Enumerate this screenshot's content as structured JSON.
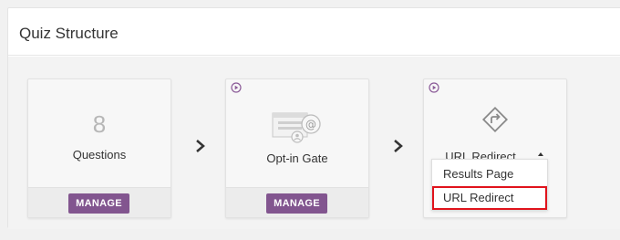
{
  "header": {
    "title": "Quiz Structure"
  },
  "cards": {
    "questions": {
      "count": "8",
      "label": "Questions",
      "button": "MANAGE"
    },
    "optin": {
      "label": "Opt-in Gate",
      "button": "MANAGE"
    },
    "redirect": {
      "label": "URL Redirect"
    }
  },
  "dropdown": {
    "options": [
      "Results Page",
      "URL Redirect"
    ],
    "selected": "URL Redirect"
  },
  "colors": {
    "accent": "#82558f",
    "highlight_outline": "#e0131c",
    "play_icon": "#8b5b98"
  },
  "icons": {
    "play": "play-circle-icon",
    "arrow": "chevron-right-icon",
    "optin": "email-form-icon",
    "redirect": "turn-right-sign-icon",
    "caret": "caret-up-icon"
  }
}
